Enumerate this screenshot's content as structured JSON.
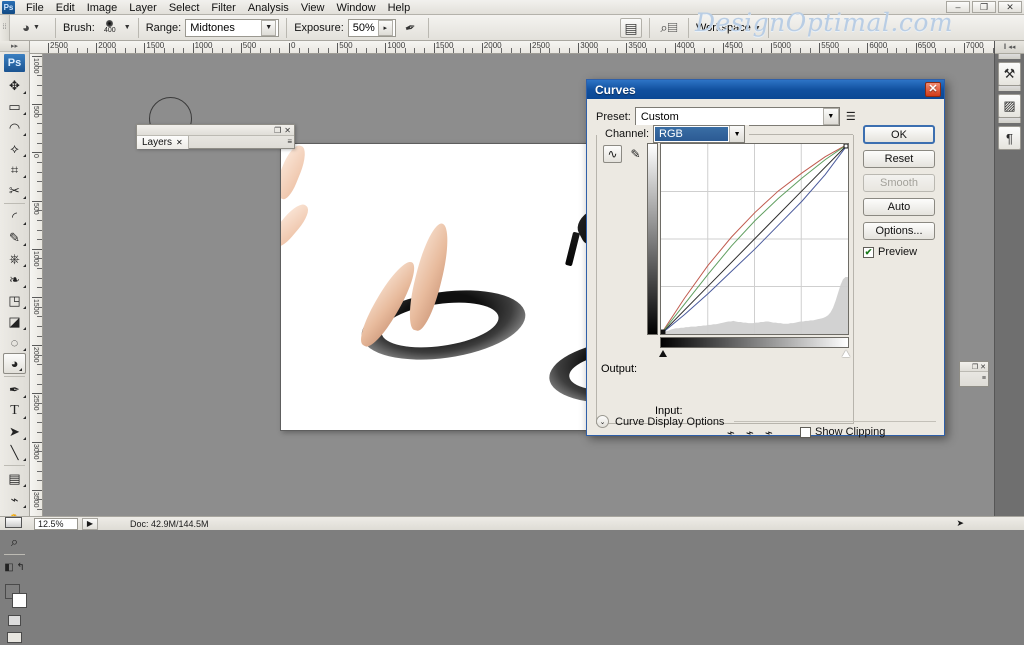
{
  "window": {
    "minimize": "–",
    "restore": "❐",
    "close": "✕"
  },
  "menubar": {
    "logo": "Ps",
    "items": [
      "File",
      "Edit",
      "Image",
      "Layer",
      "Select",
      "Filter",
      "Analysis",
      "View",
      "Window",
      "Help"
    ]
  },
  "options_bar": {
    "brush_label": "Brush:",
    "brush_size": "400",
    "range_label": "Range:",
    "range_value": "Midtones",
    "exposure_label": "Exposure:",
    "exposure_value": "50%",
    "workspace_label": "Workspace",
    "watermark": "DesignOptimal.com"
  },
  "rulers": {
    "top_labels": [
      "2500",
      "2000",
      "1500",
      "1000",
      "500",
      "0",
      "500",
      "1000",
      "1500",
      "2000",
      "2500",
      "3000",
      "3500",
      "4000",
      "4500",
      "5000",
      "5500",
      "6000",
      "6500",
      "7000"
    ],
    "left_labels": [
      "1000",
      "500",
      "0",
      "500",
      "1000",
      "1500",
      "2000",
      "2500",
      "3000",
      "3500"
    ]
  },
  "toolbar": {
    "logo": "Ps",
    "tools": [
      {
        "name": "move-tool",
        "glyph": "✥"
      },
      {
        "name": "marquee-tool",
        "glyph": "▭"
      },
      {
        "name": "lasso-tool",
        "glyph": "◠"
      },
      {
        "name": "magic-wand-tool",
        "glyph": "✨"
      },
      {
        "name": "crop-tool",
        "glyph": "⌗"
      },
      {
        "name": "slice-tool",
        "glyph": "✂"
      },
      {
        "name": "healing-brush-tool",
        "glyph": "◜"
      },
      {
        "name": "brush-tool",
        "glyph": "✎"
      },
      {
        "name": "clone-stamp-tool",
        "glyph": "⎙"
      },
      {
        "name": "history-brush-tool",
        "glyph": "❧"
      },
      {
        "name": "eraser-tool",
        "glyph": "◰"
      },
      {
        "name": "gradient-tool",
        "glyph": "◪"
      },
      {
        "name": "blur-tool",
        "glyph": "◌"
      },
      {
        "name": "dodge-burn-tool",
        "glyph": "◕"
      },
      {
        "name": "pen-tool",
        "glyph": "✒"
      },
      {
        "name": "type-tool",
        "glyph": "T"
      },
      {
        "name": "path-selection-tool",
        "glyph": "➤"
      },
      {
        "name": "line-shape-tool",
        "glyph": "╲"
      },
      {
        "name": "notes-tool",
        "glyph": "▤"
      },
      {
        "name": "eyedropper-tool",
        "glyph": "⌁"
      },
      {
        "name": "hand-tool",
        "glyph": "✋"
      },
      {
        "name": "zoom-tool",
        "glyph": "⌕"
      }
    ],
    "foreground_color": "#7f7f7f",
    "background_color": "#ffffff"
  },
  "layers_panel": {
    "tab_label": "Layers",
    "close_glyph": "✕",
    "minimize_glyph": "❐",
    "menu_glyph": "≡"
  },
  "right_dock": {
    "buttons": [
      {
        "name": "tools-preset-icon",
        "glyph": "⚒"
      },
      {
        "name": "histogram-icon",
        "glyph": "▨"
      },
      {
        "name": "paragraph-icon",
        "glyph": "¶"
      }
    ]
  },
  "curves_dialog": {
    "title": "Curves",
    "close_glyph": "✕",
    "preset_label": "Preset:",
    "preset_value": "Custom",
    "preset_menu_glyph": "☰",
    "channel_label": "Channel:",
    "channel_value": "RGB",
    "output_label": "Output:",
    "input_label": "Input:",
    "show_clipping_label": "Show Clipping",
    "show_clipping_checked": false,
    "curve_display_options_label": "Curve Display Options",
    "chevron_glyph": "⌄",
    "curve_tool_glyph": "∿",
    "pencil_tool_glyph": "✎",
    "eyedropper_glyph": "⌁",
    "buttons": [
      {
        "name": "ok-button",
        "label": "OK",
        "style": "primary"
      },
      {
        "name": "reset-button",
        "label": "Reset",
        "style": "normal"
      },
      {
        "name": "smooth-button",
        "label": "Smooth",
        "style": "disabled"
      },
      {
        "name": "auto-button",
        "label": "Auto",
        "style": "normal"
      },
      {
        "name": "options-button",
        "label": "Options...",
        "style": "normal"
      }
    ],
    "preview_label": "Preview",
    "preview_checked": true,
    "check_glyph": "✔",
    "accent_color": "#11509f"
  },
  "chart_data": {
    "type": "line",
    "title": "Curves",
    "xlabel": "Input",
    "ylabel": "Output",
    "xlim": [
      0,
      255
    ],
    "ylim": [
      0,
      255
    ],
    "grid": true,
    "grid_divisions": 4,
    "series": [
      {
        "name": "RGB",
        "color": "#2b2b2b",
        "x": [
          0,
          64,
          128,
          192,
          255
        ],
        "values": [
          0,
          64,
          128,
          192,
          255
        ]
      },
      {
        "name": "Red",
        "color": "#c05a4e",
        "x": [
          0,
          32,
          64,
          96,
          128,
          160,
          192,
          224,
          255
        ],
        "values": [
          0,
          48,
          92,
          130,
          163,
          192,
          216,
          238,
          255
        ]
      },
      {
        "name": "Green",
        "color": "#5f9e5f",
        "x": [
          0,
          32,
          64,
          96,
          128,
          160,
          192,
          224,
          255
        ],
        "values": [
          0,
          40,
          80,
          118,
          152,
          182,
          209,
          234,
          255
        ]
      },
      {
        "name": "Blue",
        "color": "#4a5a9c",
        "x": [
          0,
          32,
          64,
          96,
          128,
          160,
          192,
          224,
          255
        ],
        "values": [
          0,
          26,
          54,
          84,
          114,
          146,
          178,
          214,
          255
        ]
      }
    ],
    "histogram": [
      4,
      4,
      5,
      6,
      8,
      9,
      10,
      10,
      11,
      11,
      12,
      12,
      13,
      13,
      13,
      14,
      14,
      15,
      15,
      16,
      16,
      17,
      17,
      18,
      19,
      20,
      21,
      22,
      22,
      23,
      22,
      21,
      21,
      20,
      20,
      19,
      19,
      19,
      20,
      20,
      21,
      21,
      22,
      22,
      21,
      20,
      20,
      19,
      19,
      18,
      18,
      18,
      19,
      19,
      20,
      21,
      22,
      22,
      23,
      23,
      24,
      24,
      25,
      26,
      27,
      28,
      30,
      33,
      38,
      46,
      58,
      72,
      86,
      96,
      100,
      100
    ]
  },
  "status_bar": {
    "zoom": "12.5%",
    "doc_label": "Doc: 42.9M/144.5M",
    "arrow_glyph": "➤",
    "play_glyph": "▶"
  }
}
